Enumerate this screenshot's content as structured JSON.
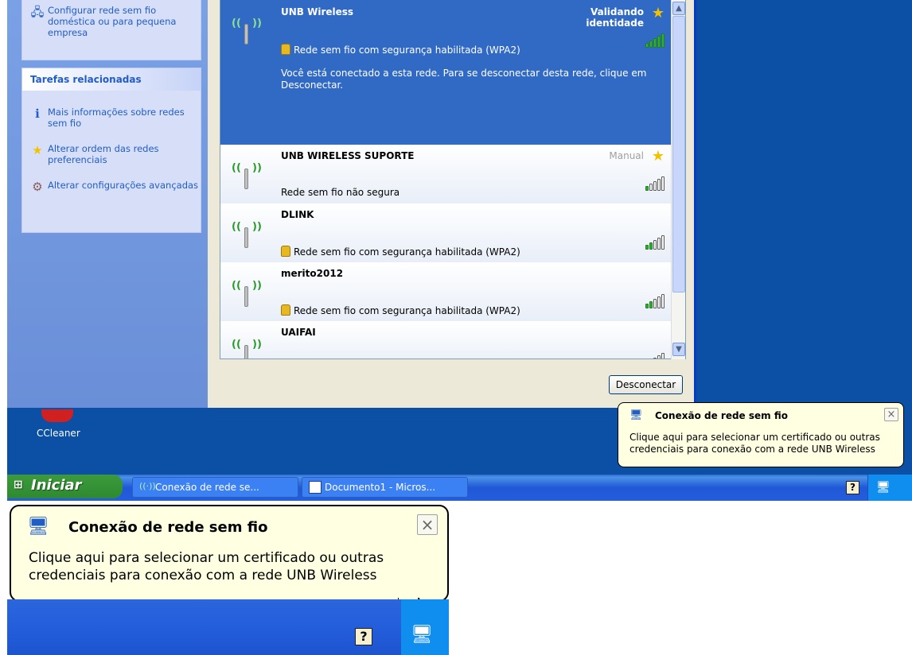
{
  "taskpane": {
    "top_item": "Configurar rede sem fio doméstica ou para pequena empresa",
    "related_header": "Tarefas relacionadas",
    "related_items": [
      "Mais informações sobre redes sem fio",
      "Alterar ordem das redes preferenciais",
      "Alterar configurações avançadas"
    ]
  },
  "networks": [
    {
      "name": "UNB Wireless",
      "status": "Validando identidade",
      "security": "Rede sem fio com segurança habilitada (WPA2)",
      "message": "Você está conectado a esta rede. Para se desconectar desta rede, clique em Desconectar.",
      "signal_bars": 5
    },
    {
      "name": "UNB WIRELESS SUPORTE",
      "status": "Manual",
      "security": "Rede sem fio não segura",
      "signal_bars": 1
    },
    {
      "name": "DLINK",
      "security": "Rede sem fio com segurança habilitada (WPA2)",
      "signal_bars": 2
    },
    {
      "name": "merito2012",
      "security": "Rede sem fio com segurança habilitada (WPA2)",
      "signal_bars": 2
    },
    {
      "name": "UAIFAI",
      "signal_bars": 1
    }
  ],
  "disconnect_button": "Desconectar",
  "desktop_icon": "CCleaner",
  "balloon": {
    "title": "Conexão de rede sem fio",
    "body": "Clique aqui para selecionar um certificado ou outras credenciais para conexão com a rede UNB Wireless",
    "close": "×"
  },
  "taskbar": {
    "start": "Iniciar",
    "buttons": [
      "Conexão de rede se...",
      "Documento1 - Micros..."
    ],
    "help": "?"
  },
  "colors": {
    "selected": "#316ac5",
    "desktop": "#0b50a4",
    "balloon": "#ffffe1",
    "link": "#215dc6"
  }
}
